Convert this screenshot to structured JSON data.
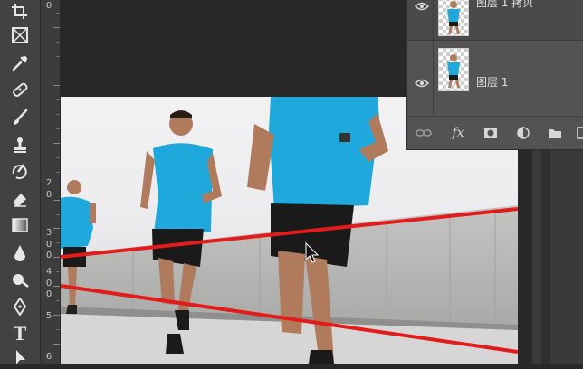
{
  "toolbar": {
    "tools": [
      {
        "name": "crop-icon"
      },
      {
        "name": "frame-icon"
      },
      {
        "name": "eyedropper-icon"
      },
      {
        "name": "healing-brush-icon"
      },
      {
        "name": "brush-icon"
      },
      {
        "name": "clone-stamp-icon"
      },
      {
        "name": "history-brush-icon"
      },
      {
        "name": "eraser-icon"
      },
      {
        "name": "gradient-icon"
      },
      {
        "name": "blur-icon"
      },
      {
        "name": "dodge-icon"
      },
      {
        "name": "pen-icon"
      },
      {
        "name": "type-icon",
        "label": "T"
      },
      {
        "name": "path-selection-icon"
      }
    ]
  },
  "ruler": {
    "numbers": [
      "0",
      "2",
      "3",
      "4",
      "5",
      "6"
    ],
    "partial_numbers": [
      "0",
      "0",
      "0",
      "0",
      "0"
    ]
  },
  "layers": [
    {
      "name": "图层 1 拷贝",
      "visible": true
    },
    {
      "name": "图层 1",
      "visible": true
    }
  ],
  "layers_footer": {
    "fx_label": "fx"
  },
  "colors": {
    "guide_line": "#e31b1b",
    "shirt": "#1ea8dc",
    "shorts": "#1a1a1a",
    "skin": "#b07a5c",
    "wall": "#b9b9b7",
    "road": "#d3d3d3"
  }
}
